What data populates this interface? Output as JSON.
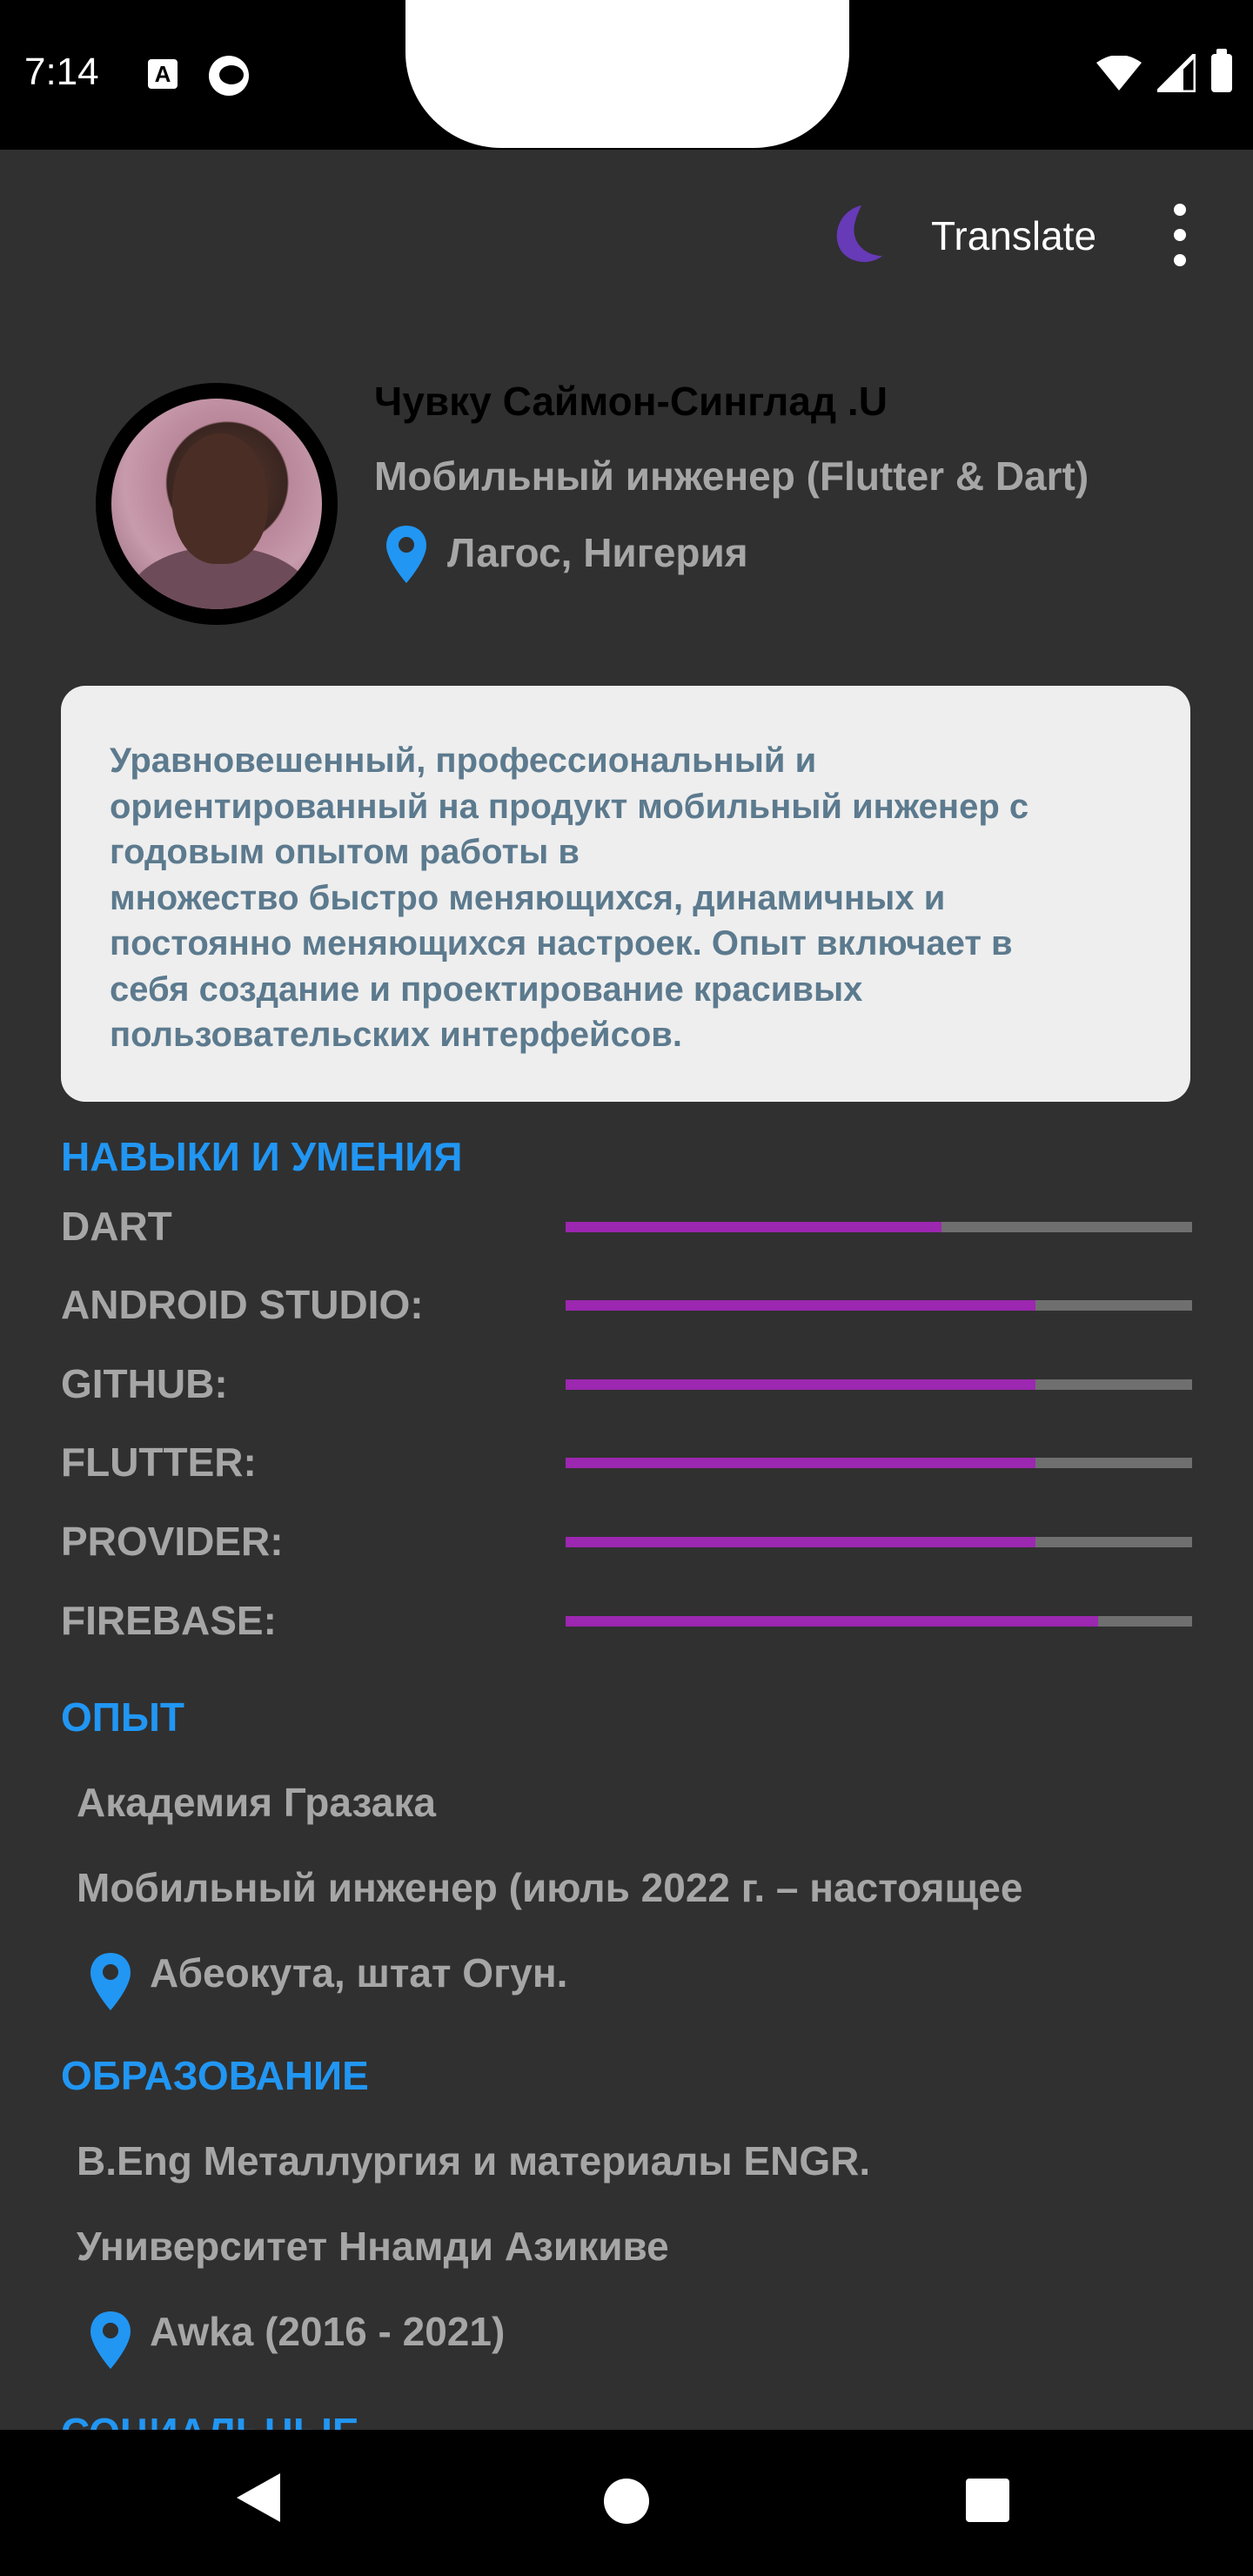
{
  "status_bar": {
    "time": "7:14",
    "icons": [
      "a-icon",
      "p-icon",
      "wifi-icon",
      "cell-signal-icon",
      "battery-icon"
    ]
  },
  "app_bar": {
    "theme_icon": "moon-icon",
    "translate_label": "Translate",
    "menu_icon": "more-vert-icon"
  },
  "profile": {
    "name": "Чувку Саймон-Синглад .U",
    "role": "Мобильный инженер (Flutter & Dart)",
    "location": "Лагос, Нигерия"
  },
  "summary": "Уравновешенный, профессиональный и\nориентированный на продукт мобильный инженер с\nгодовым опытом работы в\nмножество быстро меняющихся, динамичных и\nпостоянно меняющихся настроек. Опыт включает в\nсебя создание и проектирование красивых\nпользовательских интерфейсов.",
  "skills": {
    "title": "НАВЫКИ И УМЕНИЯ",
    "items": [
      {
        "label": "DART",
        "level": 0.6
      },
      {
        "label": "ANDROID STUDIO:",
        "level": 0.75
      },
      {
        "label": "GITHUB:",
        "level": 0.75
      },
      {
        "label": "FLUTTER:",
        "level": 0.75
      },
      {
        "label": "PROVIDER:",
        "level": 0.75
      },
      {
        "label": "FIREBASE:",
        "level": 0.85
      }
    ]
  },
  "experience": {
    "title": "ОПЫТ",
    "company": "Академия Гразака",
    "position": "Мобильный инженер (июль 2022 г. – настоящее",
    "location": "Абеокута, штат Огун."
  },
  "education": {
    "title": "ОБРАЗОВАНИЕ",
    "degree": "B.Eng Металлургия и материалы ENGR.",
    "school": "Университет Ннамди Азикиве",
    "location": "Awka (2016 - 2021)"
  },
  "social": {
    "title": "СОЦИАЛЬНЫЕ"
  },
  "colors": {
    "background": "#303030",
    "accent_blue": "#2196f3",
    "skill_fill": "#9c27b0",
    "skill_track": "#6f6f6f",
    "moon": "#673ab7"
  }
}
